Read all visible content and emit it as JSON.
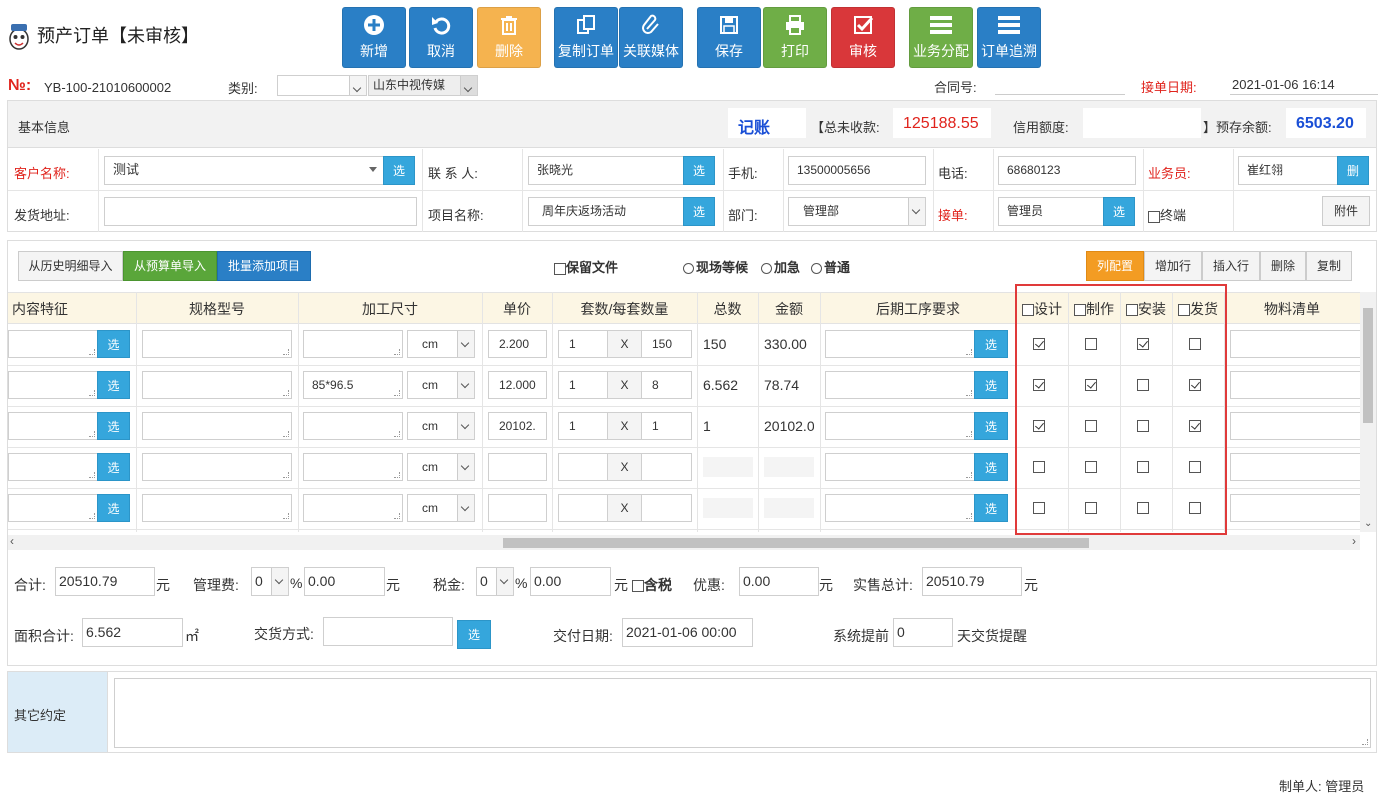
{
  "window": {
    "title": "预产订单【未审核】"
  },
  "toolbar": [
    {
      "label": "新增",
      "color": "#2a7fc6",
      "icon": "plus-icon"
    },
    {
      "label": "取消",
      "color": "#2a7fc6",
      "icon": "undo-icon"
    },
    {
      "label": "删除",
      "color": "#f5b34f",
      "icon": "trash-icon"
    },
    {
      "label": "复制订单",
      "color": "#2a7fc6",
      "icon": "copy-icon"
    },
    {
      "label": "关联媒体",
      "color": "#2a7fc6",
      "icon": "paperclip-icon"
    },
    {
      "label": "保存",
      "color": "#2a7fc6",
      "icon": "save-icon"
    },
    {
      "label": "打印",
      "color": "#6fae47",
      "icon": "printer-icon"
    },
    {
      "label": "审核",
      "color": "#d9373a",
      "icon": "check-square-icon"
    },
    {
      "label": "业务分配",
      "color": "#6fae47",
      "icon": "list-icon"
    },
    {
      "label": "订单追溯",
      "color": "#2a7fc6",
      "icon": "list-icon"
    }
  ],
  "header": {
    "no_label": "№:",
    "no_value": "YB-100-21010600002",
    "type_label": "类别:",
    "type_value": "",
    "media_value": "山东中视传媒",
    "contract_label": "合同号:",
    "contract_value": "",
    "date_label": "接单日期:",
    "date_value": "2021-01-06 16:14"
  },
  "basic": {
    "title": "基本信息",
    "mode": "记账",
    "unpaid_label": "【总未收款:",
    "unpaid_value": "125188.55",
    "credit_label": "信用额度:",
    "credit_value": "",
    "prepay_label": "】预存余额:",
    "prepay_value": "6503.20"
  },
  "form": {
    "customer_label": "客户名称:",
    "customer_value": "测试",
    "contact_label": "联 系 人:",
    "contact_value": "张晓光",
    "mobile_label": "手机:",
    "mobile_value": "13500005656",
    "phone_label": "电话:",
    "phone_value": "68680123",
    "sales_label": "业务员:",
    "sales_value": "崔红翎",
    "sales_btn": "删",
    "ship_label": "发货地址:",
    "ship_value": "",
    "project_label": "项目名称:",
    "project_value": "周年庆返场活动",
    "dept_label": "部门:",
    "dept_value": "管理部",
    "taker_label": "接单:",
    "taker_value": "管理员",
    "terminal_label": "终端",
    "attach_label": "附件",
    "select_label": "选"
  },
  "actions": {
    "import_history": "从历史明细导入",
    "import_budget": "从预算单导入",
    "batch_add": "批量添加项目",
    "keep_file": "保留文件",
    "radio_onsite": "现场等候",
    "radio_urgent": "加急",
    "radio_normal": "普通",
    "col_config": "列配置",
    "add_row": "增加行",
    "insert_row": "插入行",
    "delete": "删除",
    "copy": "复制"
  },
  "grid": {
    "headers": {
      "content": "内容特征",
      "spec": "规格型号",
      "size": "加工尺寸",
      "price": "单价",
      "qty": "套数/每套数量",
      "total": "总数",
      "amount": "金额",
      "post": "后期工序要求",
      "design": "设计",
      "make": "制作",
      "install": "安装",
      "ship": "发货",
      "bom": "物料清单"
    },
    "unit": "cm",
    "times": "X",
    "rows": [
      {
        "size": "",
        "price": "2.200",
        "sets": "1",
        "per": "150",
        "total": "150",
        "amount": "330.00",
        "design": true,
        "make": false,
        "install": true,
        "ship": false
      },
      {
        "size": "85*96.5",
        "price": "12.000",
        "sets": "1",
        "per": "8",
        "total": "6.562",
        "amount": "78.74",
        "design": true,
        "make": true,
        "install": false,
        "ship": true
      },
      {
        "size": "",
        "price": "20102.",
        "sets": "1",
        "per": "1",
        "total": "1",
        "amount": "20102.0",
        "design": true,
        "make": false,
        "install": false,
        "ship": true
      },
      {
        "size": "",
        "price": "",
        "sets": "",
        "per": "",
        "total": "",
        "amount": "",
        "design": false,
        "make": false,
        "install": false,
        "ship": false
      },
      {
        "size": "",
        "price": "",
        "sets": "",
        "per": "",
        "total": "",
        "amount": "",
        "design": false,
        "make": false,
        "install": false,
        "ship": false
      }
    ]
  },
  "totals": {
    "sum_label": "合计:",
    "sum_value": "20510.79",
    "yuan": "元",
    "mgmt_label": "管理费:",
    "mgmt_pct": "0",
    "pct": "%",
    "mgmt_value": "0.00",
    "tax_label": "税金:",
    "tax_pct": "0",
    "tax_value": "0.00",
    "tax_incl": "含税",
    "discount_label": "优惠:",
    "discount_value": "0.00",
    "actual_label": "实售总计:",
    "actual_value": "20510.79",
    "area_label": "面积合计:",
    "area_value": "6.562",
    "area_unit": "㎡",
    "delivery_label": "交货方式:",
    "delivery_value": "",
    "due_label": "交付日期:",
    "due_value": "2021-01-06 00:00",
    "remind_label": "系统提前",
    "remind_value": "0",
    "remind_suffix": "天交货提醒"
  },
  "other": {
    "label": "其它约定",
    "value": ""
  },
  "footer": {
    "maker": "制单人: 管理员"
  }
}
